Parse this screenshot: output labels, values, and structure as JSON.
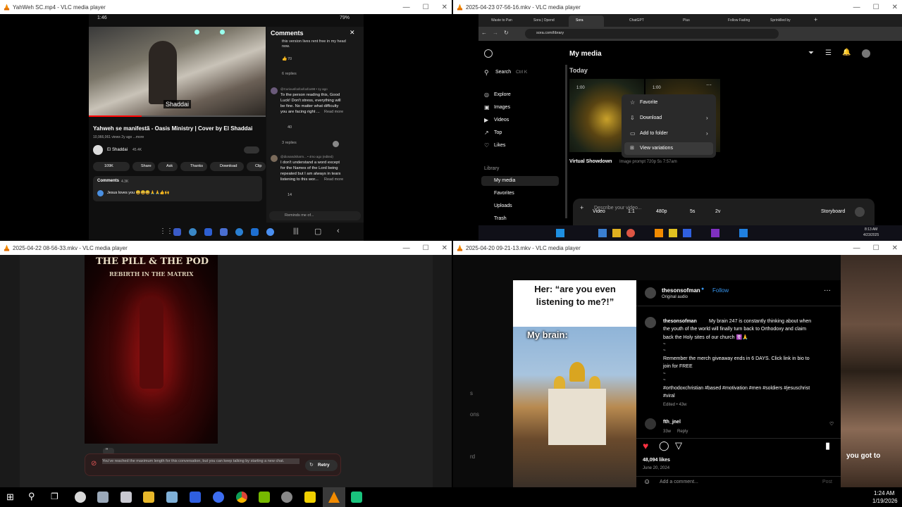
{
  "windows": {
    "w1": {
      "title": "YahWeh SC.mp4 - VLC media player",
      "status_time": "1:46",
      "status_battery": "79%",
      "video_caption": "Shaddai",
      "video_title": "Yahweh se manifestã - Oasis Ministry | Cover by El Shaddai",
      "video_meta": "10,966,061 views  2y ago  ...more",
      "channel_name": "El Shaddai",
      "subscribers": "45.4K",
      "actions": [
        "109K",
        "Share",
        "Ask",
        "Thanks",
        "Download",
        "Clip"
      ],
      "comments_mini_label": "Comments",
      "comments_mini_count": "4.3K",
      "comments_mini_text": "Jesus loves you 😀😀😀🙏🙏👍🙌",
      "panel_title": "Comments",
      "top_fragment": "this version lives rent free in my head now.",
      "top_likes": "70",
      "replies_1": "6 replies",
      "c1_user": "@Curiousfoxfoxfoxfox98 • 1y ago",
      "c1_text_1": "To the person reading this, Good",
      "c1_text_2": "Luck! Don't stress, everything will",
      "c1_text_3": "be fine. No matter what difficulty",
      "c1_text_4": "you are facing right ...",
      "c1_more": "Read more",
      "c1_likes": "40",
      "replies_2": "3 replies",
      "c2_user": "@dionandsharm... • 4mo ago (edited)",
      "c2_text_1": "I don't understand a word except",
      "c2_text_2": "for the Names of the Lord being",
      "c2_text_3": "repeated but I am always in tears",
      "c2_text_4": "listening to this wor...",
      "c2_more": "Read more",
      "c2_likes": "14",
      "reply_input": "Reminds me of..."
    },
    "w2": {
      "title": "2025-04-23 07-56-16.mkv - VLC media player",
      "tabs": [
        "Waste to Pan",
        "Sora | Opend",
        "Sora",
        "ChatGPT",
        "Plus",
        "Follow Fading",
        "Sprinklled by"
      ],
      "url": "sora.com/library",
      "page_heading": "My media",
      "search_label": "Search",
      "search_shortcut": "Ctrl K",
      "nav": [
        "Explore",
        "Images",
        "Videos",
        "Top",
        "Likes"
      ],
      "library_label": "Library",
      "library_items": [
        "My media",
        "Favorites",
        "Uploads",
        "Trash"
      ],
      "today_label": "Today",
      "thumb_a_badge": "1:00",
      "thumb_b_badge": "1:00",
      "context_menu": [
        "Favorite",
        "Download",
        "Add to folder",
        "View variations"
      ],
      "card_title": "Virtual Showdown",
      "card_meta": "Image prompt  720p  5s  7:57am",
      "composer_placeholder": "Describe your video...",
      "composer_options": [
        "Video",
        "1:1",
        "480p",
        "5s",
        "2v"
      ],
      "storyboard_label": "Storyboard",
      "clock_time": "8:13 AM",
      "clock_date": "4/23/2025"
    },
    "w3": {
      "title": "2025-04-22 08-56-33.mkv - VLC media player",
      "poster_title": "THE PILL & THE POD",
      "poster_subtitle": "REBIRTH IN THE MATRIX",
      "error_text": "You've reached the maximum length for this conversation, but you can keep talking by starting a new chat.",
      "retry_label": "Retry"
    },
    "w4": {
      "title": "2025-04-20 09-21-13.mkv - VLC media player",
      "meme_top": "Her: “are you even listening to me?!”",
      "meme_brain": "My brain:",
      "account": "thesonsofman",
      "follow": "Follow",
      "audio": "Original audio",
      "caption_user": "thesonsofman",
      "caption_1": "My brain 247 is constantly thinking about when",
      "caption_2": "the youth of the world will finally turn back to Orthodoxy and claim",
      "caption_3": "back the Holy sites of our church ☦️🙏",
      "caption_4": "Remember the merch giveaway ends in 6 DAYS. Click link in bio to",
      "caption_5": "join for FREE",
      "caption_6": "#orthodoxchristian #based #motivation #men #soldiers #jesuschrist",
      "caption_7": "#viral",
      "edited": "Edited • 43w",
      "comment_user": "fth_jnel",
      "comment_age": "33w",
      "comment_reply": "Reply",
      "likes": "48,094 likes",
      "date": "June 20, 2024",
      "add_comment": "Add a comment...",
      "post_label": "Post",
      "right_overlay": "you got to",
      "left_frag_1": "s",
      "left_frag_2": "ons",
      "left_frag_3": "rd"
    }
  },
  "taskbar": {
    "time": "1:24 AM",
    "date": "1/19/2026"
  }
}
